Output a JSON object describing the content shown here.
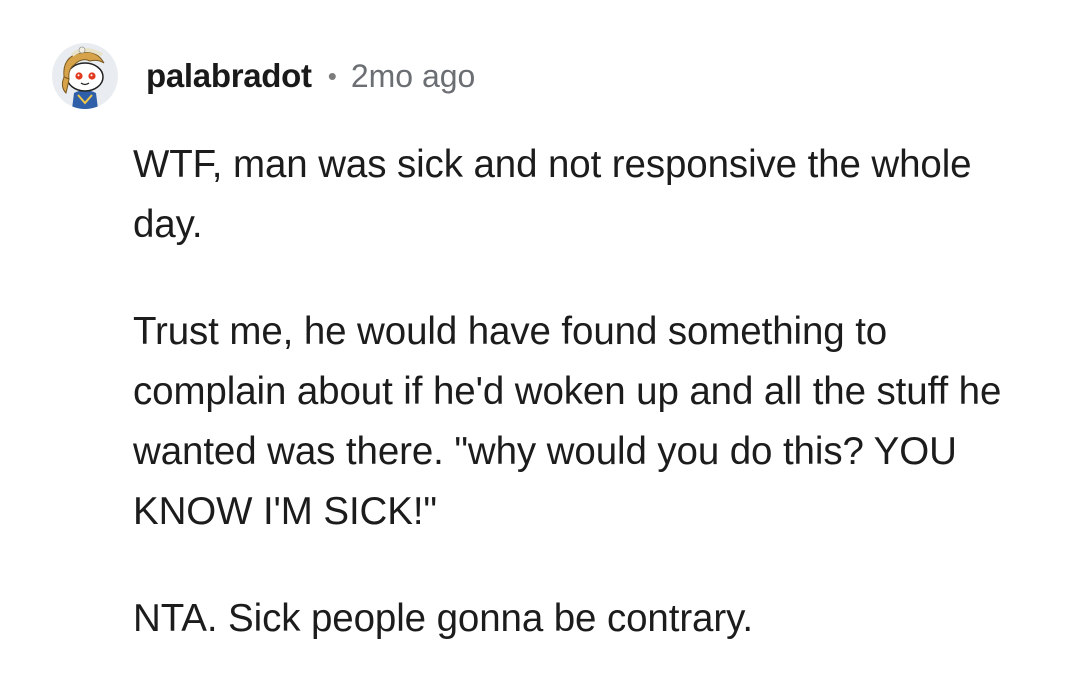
{
  "comment": {
    "avatar_icon": "reddit-snoo-avatar-icon",
    "username": "palabradot",
    "separator": "•",
    "timestamp": "2mo ago",
    "paragraphs": [
      "WTF, man was sick and not responsive the whole day.",
      "Trust me, he would have found something to complain about if he'd woken up and all the stuff he wanted was there. \"why would you do this? YOU KNOW I'M SICK!\"",
      "NTA. Sick people gonna be contrary."
    ]
  },
  "colors": {
    "background": "#ffffff",
    "text": "#1c1c1c",
    "username": "#1a1a1b",
    "meta": "#6b6f73",
    "avatar_bg": "#e9edf1"
  }
}
